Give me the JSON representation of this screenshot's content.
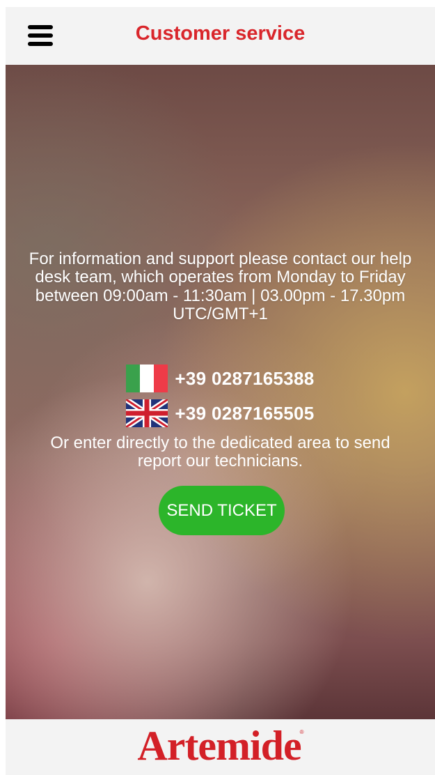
{
  "header": {
    "title": "Customer service"
  },
  "main": {
    "info_text": "For information and support please contact our help desk team, which operates from Monday to Friday between 09:00am - 11:30am | 03.00pm - 17.30pm UTC/GMT+1",
    "phones": [
      {
        "flag": "italy-flag-icon",
        "number": "+39 0287165388"
      },
      {
        "flag": "uk-flag-icon",
        "number": "+39 0287165505"
      }
    ],
    "ticket_text": "Or enter directly to the dedicated area to send report our technicians.",
    "send_ticket_label": "SEND TICKET"
  },
  "footer": {
    "logo_text": "Artemide",
    "registered_mark": "®"
  },
  "colors": {
    "title_red": "#d9262b",
    "button_green": "#2cb52a",
    "logo_red": "#d32027",
    "bar_bg": "#f3f3f3"
  }
}
